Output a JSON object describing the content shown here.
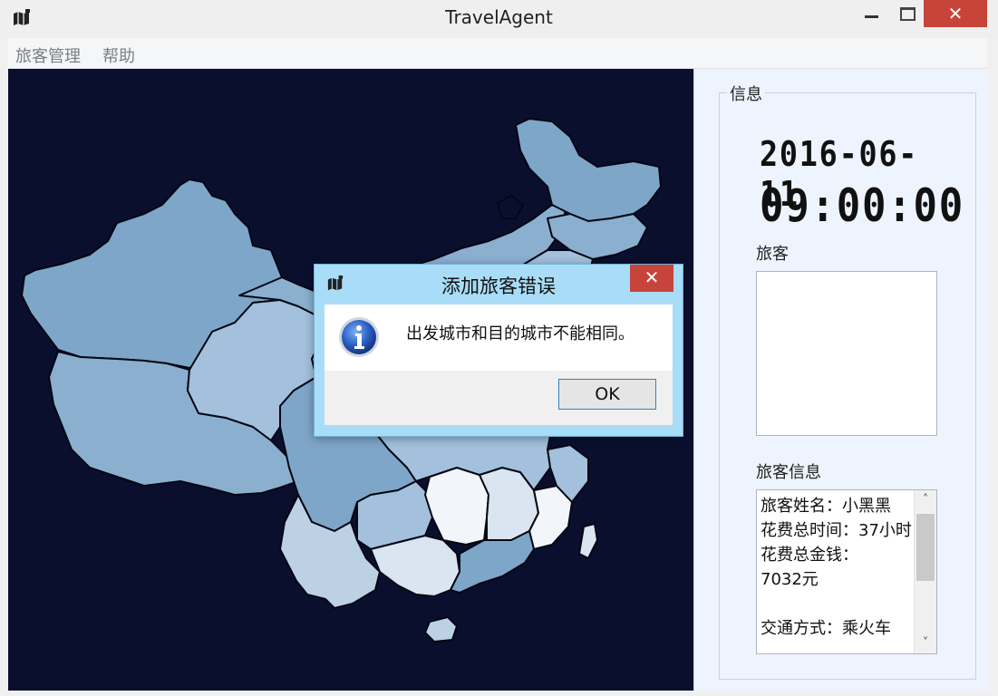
{
  "window": {
    "title": "TravelAgent",
    "close_glyph": "✕",
    "icon": "map-icon"
  },
  "menu": {
    "items": [
      "旅客管理",
      "帮助"
    ]
  },
  "map": {
    "background": "#0a0f2e",
    "fill_colors": [
      "#7ea6c8",
      "#8bafcf",
      "#a3c0dc",
      "#bdd1e5",
      "#d9e5f1",
      "#f2f6fa"
    ]
  },
  "sidebar": {
    "group_title": "信息",
    "date": "2016-06-11",
    "time": "09:00:00",
    "traveler_label": "旅客",
    "traveler_list": [],
    "info_label": "旅客信息",
    "info_text": "旅客姓名：小黑黑\n花费总时间：37小时\n花费总金钱：\n7032元\n\n交通方式：乘火车",
    "scroll_up": "˄",
    "scroll_down": "˅"
  },
  "dialog": {
    "title": "添加旅客错误",
    "message": "出发城市和目的城市不能相同。",
    "ok_label": "OK",
    "close_glyph": "✕",
    "icon": "info-icon"
  }
}
